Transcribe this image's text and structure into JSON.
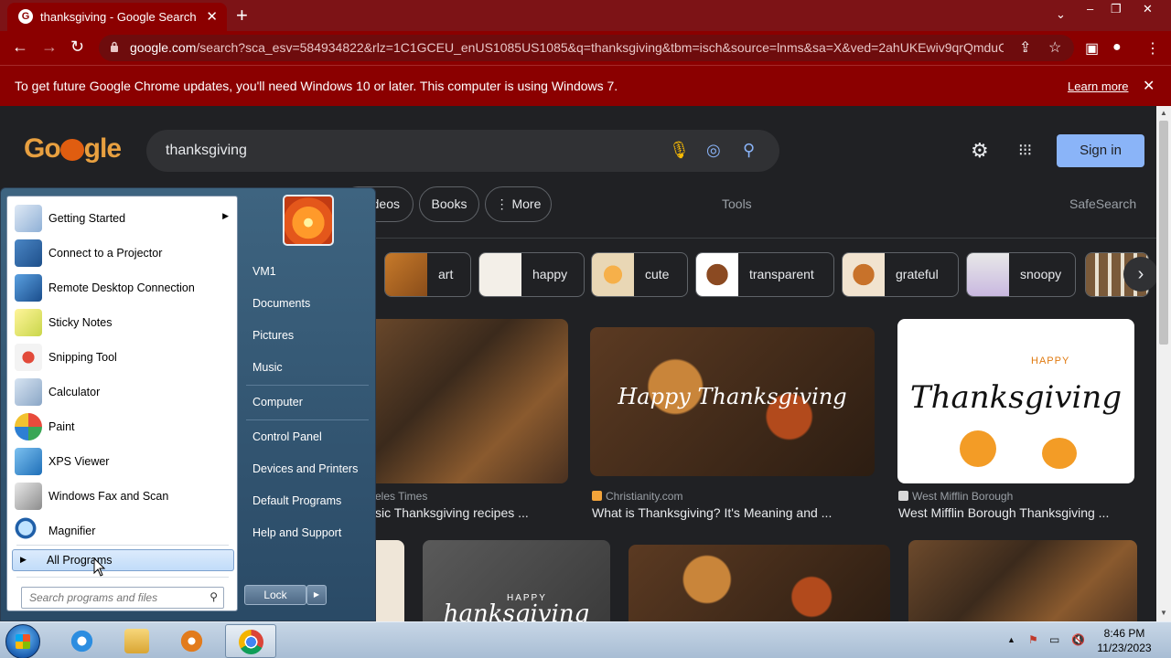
{
  "browser": {
    "tab_title": "thanksgiving - Google Search",
    "url_domain": "google.com",
    "url_path": "/search?sca_esv=584934822&rlz=1C1GCEU_enUS1085US1085&q=thanksgiving&tbm=isch&source=lnms&sa=X&ved=2ahUKEwiv9qrQmduC...",
    "infobar_message": "To get future Google Chrome updates, you'll need Windows 10 or later. This computer is using Windows 7.",
    "infobar_link": "Learn more",
    "theme_color": "#8b0000"
  },
  "google": {
    "query": "thanksgiving",
    "sign_in": "Sign in",
    "tabs": [
      "deos",
      "Books",
      "More"
    ],
    "tools": "Tools",
    "safesearch": "SafeSearch",
    "chips": [
      "art",
      "happy",
      "cute",
      "transparent",
      "grateful",
      "snoopy"
    ],
    "results": [
      {
        "source": "eles Times",
        "title": "sic Thanksgiving recipes ...",
        "image_text": ""
      },
      {
        "source": "Christianity.com",
        "title": "What is Thanksgiving? It's Meaning and ...",
        "image_text": "Happy Thanksgiving"
      },
      {
        "source": "West Mifflin Borough",
        "title": "West Mifflin Borough Thanksgiving ...",
        "image_text": "Thanksgiving",
        "image_text_top": "HAPPY"
      }
    ],
    "second_row": [
      {
        "image_text": "HAPPY",
        "image_text_2": "hanksgiving"
      }
    ]
  },
  "start_menu": {
    "programs": [
      {
        "name": "Getting Started",
        "icon": "getting-started-icon",
        "submenu": true
      },
      {
        "name": "Connect to a Projector",
        "icon": "projector-icon",
        "submenu": false
      },
      {
        "name": "Remote Desktop Connection",
        "icon": "remote-desktop-icon",
        "submenu": false
      },
      {
        "name": "Sticky Notes",
        "icon": "sticky-notes-icon",
        "submenu": false
      },
      {
        "name": "Snipping Tool",
        "icon": "snipping-tool-icon",
        "submenu": false
      },
      {
        "name": "Calculator",
        "icon": "calculator-icon",
        "submenu": false
      },
      {
        "name": "Paint",
        "icon": "paint-icon",
        "submenu": false
      },
      {
        "name": "XPS Viewer",
        "icon": "xps-viewer-icon",
        "submenu": false
      },
      {
        "name": "Windows Fax and Scan",
        "icon": "fax-scan-icon",
        "submenu": false
      },
      {
        "name": "Magnifier",
        "icon": "magnifier-icon",
        "submenu": false
      }
    ],
    "all_programs": "All Programs",
    "search_placeholder": "Search programs and files",
    "right_links": [
      "VM1",
      "Documents",
      "Pictures",
      "Music",
      "Computer",
      "Control Panel",
      "Devices and Printers",
      "Default Programs",
      "Help and Support"
    ],
    "lock_label": "Lock"
  },
  "taskbar": {
    "time": "8:46 PM",
    "date": "11/23/2023"
  }
}
